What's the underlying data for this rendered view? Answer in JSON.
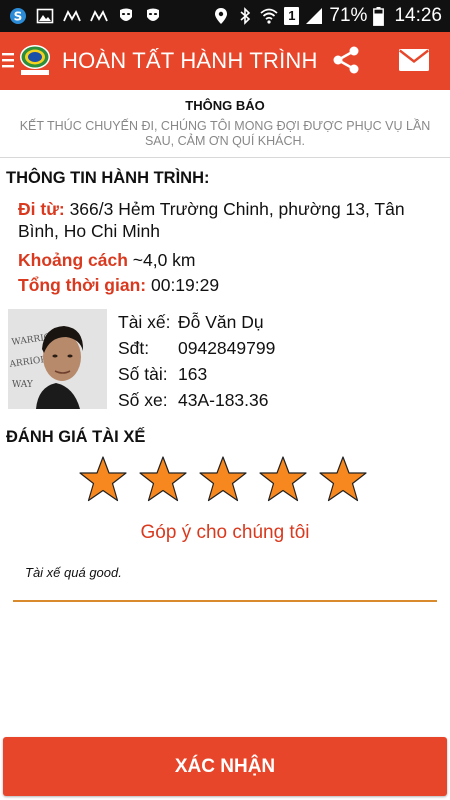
{
  "status_bar": {
    "battery_percent": "71%",
    "time": "14:26",
    "sim_slot": "1",
    "icons": [
      "skype-icon",
      "image-icon",
      "wave-icon",
      "wave-icon",
      "mask-icon",
      "mask-icon"
    ]
  },
  "app_bar": {
    "title": "HOÀN TẤT HÀNH TRÌNH",
    "logo_text": "TAXI HOANG SA"
  },
  "notice": {
    "title": "THÔNG BÁO",
    "body": "KẾT THÚC CHUYẾN ĐI, CHÚNG TÔI MONG ĐỢI ĐƯỢC PHỤC VỤ LẦN SAU, CẢM ƠN QUÍ KHÁCH."
  },
  "trip": {
    "section_title": "THÔNG TIN HÀNH TRÌNH:",
    "from_label": "Đi từ:",
    "from_value": "366/3 Hẻm Trường Chinh, phường 13, Tân Bình, Ho Chi Minh",
    "distance_label": "Khoảng cách",
    "distance_value": "~4,0 km",
    "duration_label": "Tổng thời gian:",
    "duration_value": "00:19:29"
  },
  "driver": {
    "name_label": "Tài xế:",
    "name_value": "Đỗ Văn Dụ",
    "phone_label": "Sđt:",
    "phone_value": "0942849799",
    "driver_no_label": "Số tài:",
    "driver_no_value": "163",
    "plate_label": "Số xe:",
    "plate_value": "43A-183.36"
  },
  "rating": {
    "section_title": "ĐÁNH GIÁ TÀI XẾ",
    "stars": 5,
    "max_stars": 5,
    "star_color": "#f7881f"
  },
  "feedback": {
    "link_label": "Góp ý cho chúng tôi",
    "comment_value": "Tài xế quá good."
  },
  "confirm_label": "XÁC NHẬN",
  "colors": {
    "brand": "#e8462a",
    "label": "#d93a1f"
  }
}
